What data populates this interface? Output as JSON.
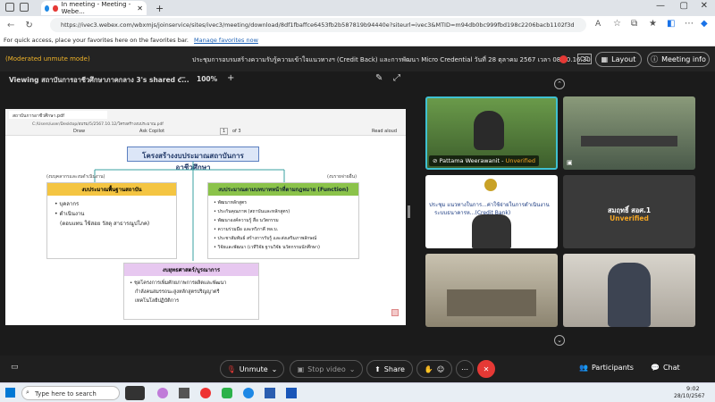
{
  "browser": {
    "tab_title": "In meeting - Meeting - Webe...",
    "url": "https://ivec3.webex.com/wbxmjs/joinservice/sites/ivec3/meeting/download/8df1fbaffce6453fb2b587819b94440e?siteurl=ivec3&MTID=m94db0bc999fbd198c2206bacb1102f3d",
    "favbar_text": "For quick access, place your favorites here on the favorites bar.",
    "favbar_link": "Manage favorites now"
  },
  "meeting": {
    "moderated": "(Moderated unmute mode)",
    "title": "ประชุมการอบรมสร้างความรับรู้ความเข้าใจแนวทางฯ (Credit Back) และการพัฒนา Micro Credential วันที่ 28 ตุลาคม 2567 เวลา 08.00.16.30",
    "cc": "CC",
    "layout": "Layout",
    "info": "Meeting info"
  },
  "share": {
    "viewing": "Viewing สถาบันการอาชีวศึกษาภาคกลาง 3's shared c...",
    "zoom_minus": "−",
    "zoom": "100%",
    "zoom_plus": "+"
  },
  "pdf": {
    "tab": "สถาบันการอาชีวศึกษา.pdf",
    "path": "C:/Users/user/Desktop/อบรม/5/2567.10.12/โครงสร้างงบประมาณ.pdf",
    "page": "1",
    "of_pages": "of 3",
    "ask_copilot": "Ask Copilot",
    "draw": "Draw",
    "read_aloud": "Read aloud"
  },
  "doc": {
    "title": "โครงสร้างงบประมาณสถาบันการอาชีวศึกษา",
    "left_note": "(งบบุคลากรและงบดำเนินงาน)",
    "right_note": "(งบรายจ่ายอื่น)",
    "box1_title": "งบประมาณพื้นฐานสถาบัน",
    "box1_items": [
      "บุคลากร",
      "ดำเนินงาน",
      "(ตอบแทน ใช้สอย วัสดุ สาธารณูปโภค)"
    ],
    "box2_title": "งบประมาณตามบทบาทหน้าที่ตามกฎหมาย (Function)",
    "box2_items": [
      "พัฒนาหลักสูตร",
      "ประกันคุณภาพ (สถาบันและหลักสูตร)",
      "พัฒนาองค์ความรู้ สื่อ นวัตกรรม",
      "ความร่วมมือ และทวิภาคี ทล.บ.",
      "ประชาสัมพันธ์ สร้างการรับรู้ และส่งเสริมภาพลักษณ์",
      "วิจัยและพัฒนา (เวทีวิจัย ฐานวิจัย นวัตกรรมนักศึกษา)"
    ],
    "box3_title": "งบยุทธศาสตร์/บูรณาการ",
    "box3_items": [
      "ชุดโครงการเพิ่มศักยภาพการผลิตและพัฒนา",
      "กำลังคนสมรรถนะสูงหลักสูตรปริญญาตรี",
      "เทคโนโลยีปฏิบัติการ"
    ]
  },
  "participants": [
    {
      "name": "Pattama Weerawanit",
      "status": "Unverified"
    },
    {
      "name": "",
      "status": ""
    },
    {
      "name": "",
      "status": "",
      "banner1": "ประชุม แนวทางในการ...ค่าใช้จ่ายในการดำเนินงาน",
      "banner2": "ระบบธนาคารห...(Credit Bank)"
    },
    {
      "name": "สมฤทธิ์ สอศ.1",
      "status": "Unverified"
    },
    {
      "name": "",
      "status": ""
    },
    {
      "name": "",
      "status": ""
    }
  ],
  "toolbar": {
    "unmute": "Unmute",
    "stop_video": "Stop video",
    "share": "Share",
    "participants": "Participants",
    "chat": "Chat"
  },
  "taskbar": {
    "search_placeholder": "Type here to search",
    "time": "9:02",
    "date": "28/10/2567"
  }
}
